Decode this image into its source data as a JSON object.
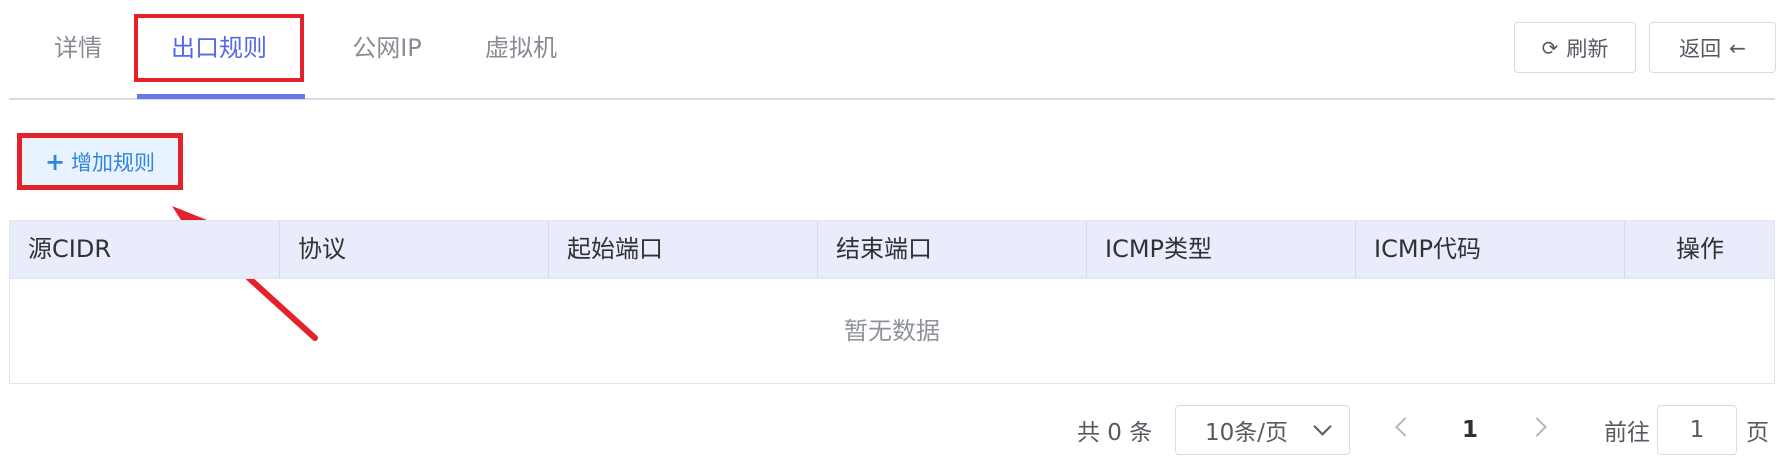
{
  "tabs": [
    {
      "label": "详情"
    },
    {
      "label": "出口规则"
    },
    {
      "label": "公网IP"
    },
    {
      "label": "虚拟机"
    }
  ],
  "toolbar": {
    "refresh_label": "刷新",
    "back_label": "返回"
  },
  "add_rule_label": "增加规则",
  "table": {
    "columns": [
      "源CIDR",
      "协议",
      "起始端口",
      "结束端口",
      "ICMP类型",
      "ICMP代码",
      "操作"
    ],
    "empty_text": "暂无数据"
  },
  "pagination": {
    "total_text": "共 0 条",
    "page_size": "10条/页",
    "current_page": "1",
    "goto_label": "前往",
    "goto_value": "1",
    "goto_suffix": "页"
  },
  "colors": {
    "active_tab": "#5468e8",
    "highlight_border": "#e5222c",
    "table_header_bg": "#e9edfb",
    "add_button_bg": "#e8f3ff"
  }
}
